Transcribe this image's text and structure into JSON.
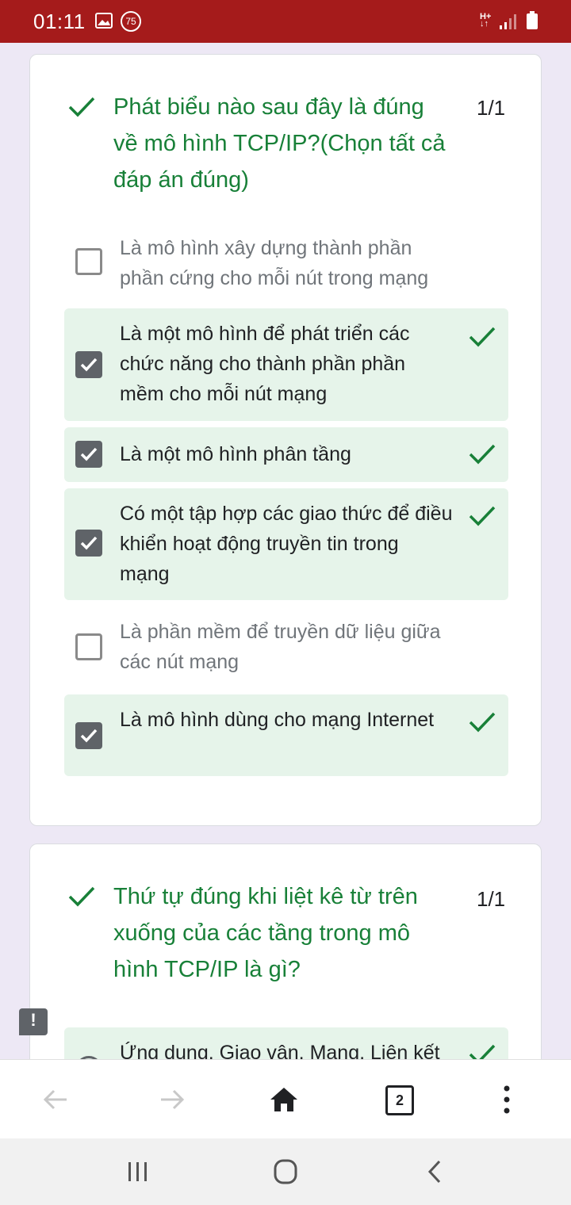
{
  "status_bar": {
    "time": "01:11",
    "notification_badge": "75",
    "network_type": "H+"
  },
  "question_1": {
    "title": "Phát biểu nào sau đây là đúng về mô hình TCP/IP?(Chọn tất cả đáp án đúng)",
    "score": "1/1",
    "options": [
      {
        "text": "Là mô hình xây dựng thành phần phần cứng cho mỗi nút trong mạng",
        "selected": false,
        "correct": false
      },
      {
        "text": "Là một mô hình để phát triển các chức năng cho thành phần phần mềm cho mỗi nút mạng",
        "selected": true,
        "correct": true
      },
      {
        "text": "Là một mô hình phân tầng",
        "selected": true,
        "correct": true
      },
      {
        "text": "Có một tập hợp các giao thức để điều khiển hoạt động truyền tin trong mạng",
        "selected": true,
        "correct": true
      },
      {
        "text": "Là phần mềm để truyền dữ liệu giữa các nút mạng",
        "selected": false,
        "correct": false
      },
      {
        "text": "Là mô hình dùng cho mạng Internet",
        "selected": true,
        "correct": true
      }
    ]
  },
  "question_2": {
    "title": "Thứ tự đúng khi liệt kê từ trên xuống của các tầng trong mô hình TCP/IP là gì?",
    "score": "1/1",
    "options": [
      {
        "text": "Ứng dụng, Giao vận, Mạng, Liên kết",
        "selected": true,
        "correct": true
      }
    ]
  },
  "report_button": {
    "label": "!"
  },
  "browser_toolbar": {
    "tab_count": "2"
  },
  "colors": {
    "status_bar": "#a51b1b",
    "correct_green": "#188038",
    "correct_bg": "#e6f4ea",
    "page_bg": "#ede8f5"
  },
  "icons": [
    "image-icon",
    "notification-badge-icon",
    "signal-icon",
    "battery-icon",
    "check-icon",
    "checkbox-checked-icon",
    "checkbox-empty-icon",
    "back-arrow-icon",
    "forward-arrow-icon",
    "home-icon",
    "tab-switcher-icon",
    "overflow-menu-icon",
    "recents-icon",
    "home-nav-icon",
    "back-nav-icon",
    "report-icon"
  ]
}
